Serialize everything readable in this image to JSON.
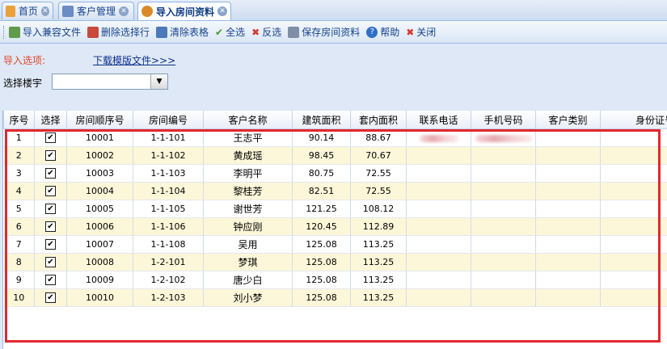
{
  "tabs": [
    {
      "label": "首页",
      "active": false
    },
    {
      "label": "客户管理",
      "active": false
    },
    {
      "label": "导入房间资料",
      "active": true
    }
  ],
  "toolbar": {
    "import": "导入兼容文件",
    "delete_selected": "删除选择行",
    "clear_table": "清除表格",
    "select_all": "全选",
    "invert": "反选",
    "save": "保存房间资料",
    "help": "帮助",
    "close": "关闭"
  },
  "options": {
    "label": "导入选项:",
    "download_link": "下载模版文件>>>",
    "building_label": "选择楼宇",
    "building_value": ""
  },
  "grid": {
    "columns": [
      "序号",
      "选择",
      "房间顺序号",
      "房间编号",
      "客户名称",
      "建筑面积",
      "套内面积",
      "联系电话",
      "手机号码",
      "客户类别",
      "身份证号"
    ],
    "rows": [
      {
        "n": "1",
        "seq": "10001",
        "room": "1-1-101",
        "name": "王志平",
        "area": "90.14",
        "inner": "88.67",
        "checked": true
      },
      {
        "n": "2",
        "seq": "10002",
        "room": "1-1-102",
        "name": "黄成瑶",
        "area": "98.45",
        "inner": "70.67",
        "checked": true
      },
      {
        "n": "3",
        "seq": "10003",
        "room": "1-1-103",
        "name": "李明平",
        "area": "80.75",
        "inner": "72.55",
        "checked": true
      },
      {
        "n": "4",
        "seq": "10004",
        "room": "1-1-104",
        "name": "黎桂芳",
        "area": "82.51",
        "inner": "72.55",
        "checked": true
      },
      {
        "n": "5",
        "seq": "10005",
        "room": "1-1-105",
        "name": "谢世芳",
        "area": "121.25",
        "inner": "108.12",
        "checked": true
      },
      {
        "n": "6",
        "seq": "10006",
        "room": "1-1-106",
        "name": "钟应刚",
        "area": "120.45",
        "inner": "112.89",
        "checked": true
      },
      {
        "n": "7",
        "seq": "10007",
        "room": "1-1-108",
        "name": "吴用",
        "area": "125.08",
        "inner": "113.25",
        "checked": true
      },
      {
        "n": "8",
        "seq": "10008",
        "room": "1-2-101",
        "name": "梦琪",
        "area": "125.08",
        "inner": "113.25",
        "checked": true
      },
      {
        "n": "9",
        "seq": "10009",
        "room": "1-2-102",
        "name": "唐少白",
        "area": "125.08",
        "inner": "113.25",
        "checked": true
      },
      {
        "n": "10",
        "seq": "10010",
        "room": "1-2-103",
        "name": "刘小梦",
        "area": "125.08",
        "inner": "113.25",
        "checked": true
      }
    ]
  },
  "colors": {
    "highlight_border": "#e0282e",
    "alt_row": "#fdf7d9"
  }
}
